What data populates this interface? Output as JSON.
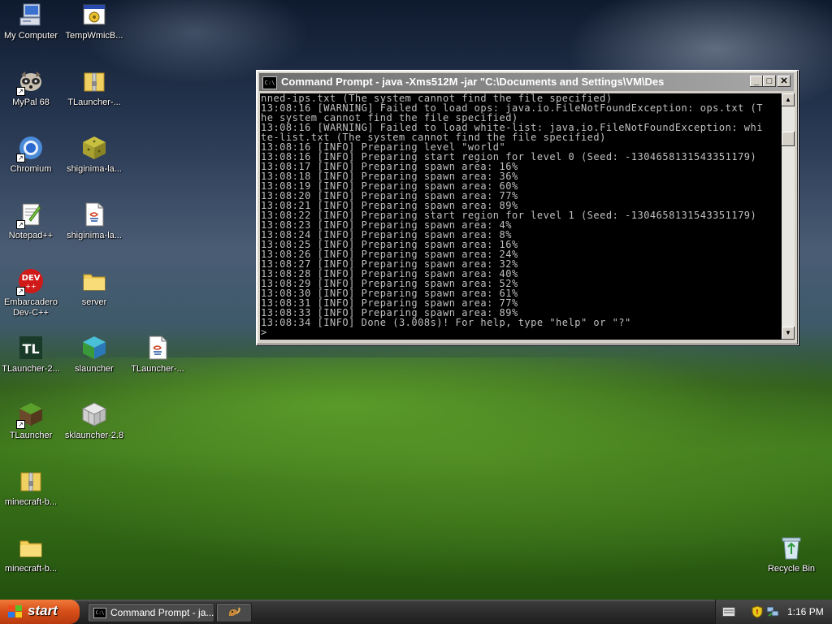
{
  "desktop": {
    "icons": [
      {
        "label": "My Computer",
        "icon": "computer-icon"
      },
      {
        "label": "TempWmicB...",
        "icon": "batch-file-icon"
      },
      {
        "label": "MyPal 68",
        "icon": "raccoon-browser-icon"
      },
      {
        "label": "TLauncher-...",
        "icon": "zip-folder-icon"
      },
      {
        "label": "Chromium",
        "icon": "chromium-icon"
      },
      {
        "label": "shiginima-la...",
        "icon": "sponge-block-icon"
      },
      {
        "label": "Notepad++",
        "icon": "notepad-plus-plus-icon"
      },
      {
        "label": "shiginima-la...",
        "icon": "java-file-icon"
      },
      {
        "label": "Embarcadero\nDev-C++",
        "label_line1": "Embarcadero",
        "label_line2": "Dev-C++",
        "icon": "dev-cpp-icon"
      },
      {
        "label": "server",
        "icon": "folder-icon"
      },
      {
        "label": "TLauncher-2...",
        "icon": "tl-icon"
      },
      {
        "label": "slauncher",
        "icon": "cube-icon"
      },
      {
        "label": "TLauncher-...",
        "icon": "java-file-icon"
      },
      {
        "label": "TLauncher",
        "icon": "grass-block-icon"
      },
      {
        "label": "sklauncher-2.8",
        "icon": "wire-cube-icon"
      },
      {
        "label": "minecraft-b...",
        "icon": "zip-folder-icon"
      },
      {
        "label": "minecraft-b...",
        "icon": "folder-icon"
      },
      {
        "label": "Recycle Bin",
        "icon": "recycle-bin-icon"
      }
    ]
  },
  "window": {
    "title": "Command Prompt - java -Xms512M -jar \"C:\\Documents and Settings\\VM\\Des",
    "title_icon_text": "C:\\",
    "minimize": "_",
    "maximize": "□",
    "close": "✕",
    "console_lines": [
      "nned-ips.txt (The system cannot find the file specified)",
      "13:08:16 [WARNING] Failed to load ops: java.io.FileNotFoundException: ops.txt (T",
      "he system cannot find the file specified)",
      "13:08:16 [WARNING] Failed to load white-list: java.io.FileNotFoundException: whi",
      "te-list.txt (The system cannot find the file specified)",
      "13:08:16 [INFO] Preparing level \"world\"",
      "13:08:16 [INFO] Preparing start region for level 0 (Seed: -1304658131543351179)",
      "13:08:17 [INFO] Preparing spawn area: 16%",
      "13:08:18 [INFO] Preparing spawn area: 36%",
      "13:08:19 [INFO] Preparing spawn area: 60%",
      "13:08:20 [INFO] Preparing spawn area: 77%",
      "13:08:21 [INFO] Preparing spawn area: 89%",
      "13:08:22 [INFO] Preparing start region for level 1 (Seed: -1304658131543351179)",
      "13:08:23 [INFO] Preparing spawn area: 4%",
      "13:08:24 [INFO] Preparing spawn area: 8%",
      "13:08:25 [INFO] Preparing spawn area: 16%",
      "13:08:26 [INFO] Preparing spawn area: 24%",
      "13:08:27 [INFO] Preparing spawn area: 32%",
      "13:08:28 [INFO] Preparing spawn area: 40%",
      "13:08:29 [INFO] Preparing spawn area: 52%",
      "13:08:30 [INFO] Preparing spawn area: 61%",
      "13:08:31 [INFO] Preparing spawn area: 77%",
      "13:08:33 [INFO] Preparing spawn area: 89%",
      "13:08:34 [INFO] Done (3.008s)! For help, type \"help\" or \"?\"",
      ">"
    ]
  },
  "taskbar": {
    "start_label": "start",
    "tasks": [
      {
        "label": "Command Prompt - ja...",
        "icon": "cmd-icon"
      },
      {
        "label": "",
        "icon": "squirrel-icon"
      }
    ],
    "tray_icons": [
      "keyboard-icon",
      "shield-icon",
      "network-icon"
    ],
    "clock": "1:16 PM"
  },
  "colors": {
    "console_bg": "#000000",
    "console_text": "#c0c0c0",
    "start_button": "#d8501a",
    "taskbar": "#2a2a2a"
  }
}
